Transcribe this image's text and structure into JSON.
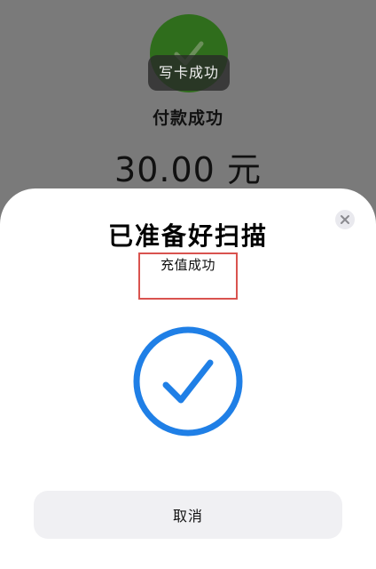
{
  "background": {
    "toast_text": "写卡成功",
    "payment_status": "付款成功",
    "amount": "30.00",
    "currency": "元",
    "success_color": "#2f6d1c"
  },
  "sheet": {
    "title": "已准备好扫描",
    "status": "充值成功",
    "close_icon": "close-icon",
    "check_icon": "checkmark-circle-icon",
    "check_color": "#1f7fe6",
    "highlight_color": "#d9534f",
    "cancel_label": "取消"
  }
}
